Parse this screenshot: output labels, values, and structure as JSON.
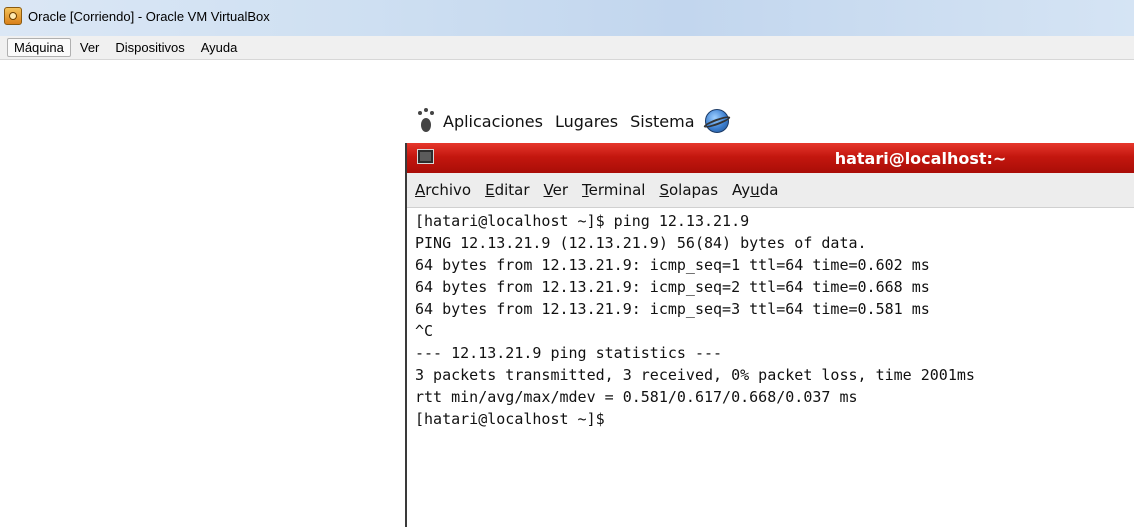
{
  "host_window": {
    "title": "Oracle [Corriendo] - Oracle VM VirtualBox",
    "menu": [
      {
        "label": "Máquina",
        "active": true
      },
      {
        "label": "Ver",
        "active": false
      },
      {
        "label": "Dispositivos",
        "active": false
      },
      {
        "label": "Ayuda",
        "active": false
      }
    ]
  },
  "gnome_panel": {
    "menu": [
      "Aplicaciones",
      "Lugares",
      "Sistema"
    ],
    "icons": [
      "gnome-foot-icon",
      "network-globe-icon"
    ]
  },
  "terminal": {
    "title": "hatari@localhost:~",
    "titlebar_color": "#c4170f",
    "menu": [
      {
        "label": "Archivo",
        "mnemonic": "A"
      },
      {
        "label": "Editar",
        "mnemonic": "E"
      },
      {
        "label": "Ver",
        "mnemonic": "V"
      },
      {
        "label": "Terminal",
        "mnemonic": "T"
      },
      {
        "label": "Solapas",
        "mnemonic": "S"
      },
      {
        "label": "Ayuda",
        "mnemonic": "u"
      }
    ],
    "lines": [
      "[hatari@localhost ~]$ ping 12.13.21.9",
      "PING 12.13.21.9 (12.13.21.9) 56(84) bytes of data.",
      "64 bytes from 12.13.21.9: icmp_seq=1 ttl=64 time=0.602 ms",
      "64 bytes from 12.13.21.9: icmp_seq=2 ttl=64 time=0.668 ms",
      "64 bytes from 12.13.21.9: icmp_seq=3 ttl=64 time=0.581 ms",
      "^C",
      "--- 12.13.21.9 ping statistics ---",
      "3 packets transmitted, 3 received, 0% packet loss, time 2001ms",
      "rtt min/avg/max/mdev = 0.581/0.617/0.668/0.037 ms",
      "[hatari@localhost ~]$"
    ]
  }
}
